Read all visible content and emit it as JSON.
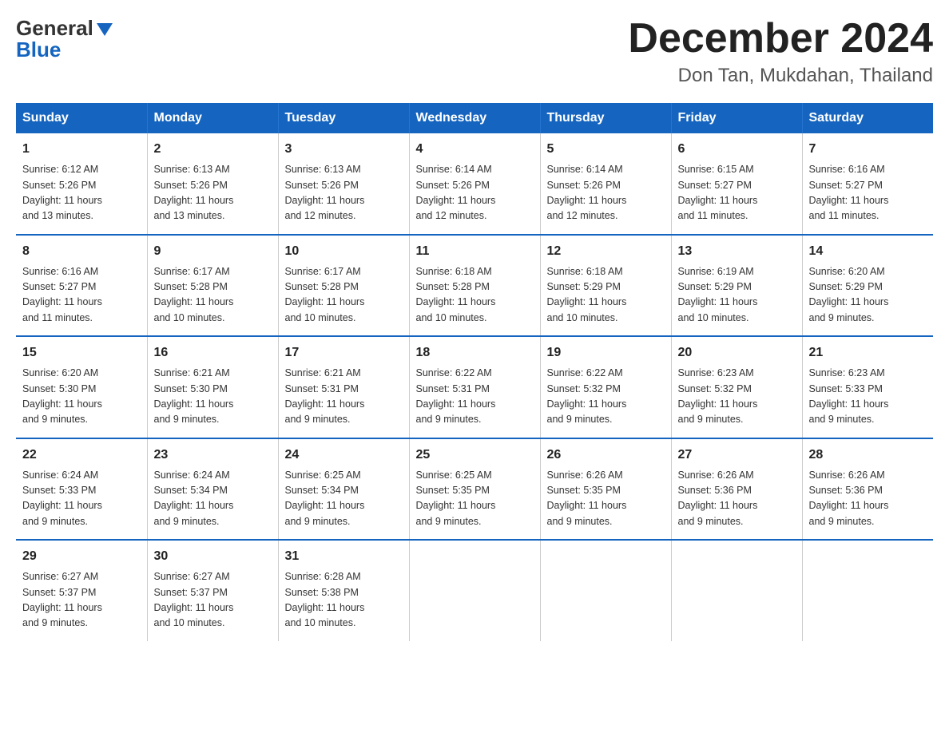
{
  "logo": {
    "general": "General",
    "blue": "Blue"
  },
  "title": "December 2024",
  "subtitle": "Don Tan, Mukdahan, Thailand",
  "days_of_week": [
    "Sunday",
    "Monday",
    "Tuesday",
    "Wednesday",
    "Thursday",
    "Friday",
    "Saturday"
  ],
  "weeks": [
    [
      {
        "day": "1",
        "info": "Sunrise: 6:12 AM\nSunset: 5:26 PM\nDaylight: 11 hours\nand 13 minutes."
      },
      {
        "day": "2",
        "info": "Sunrise: 6:13 AM\nSunset: 5:26 PM\nDaylight: 11 hours\nand 13 minutes."
      },
      {
        "day": "3",
        "info": "Sunrise: 6:13 AM\nSunset: 5:26 PM\nDaylight: 11 hours\nand 12 minutes."
      },
      {
        "day": "4",
        "info": "Sunrise: 6:14 AM\nSunset: 5:26 PM\nDaylight: 11 hours\nand 12 minutes."
      },
      {
        "day": "5",
        "info": "Sunrise: 6:14 AM\nSunset: 5:26 PM\nDaylight: 11 hours\nand 12 minutes."
      },
      {
        "day": "6",
        "info": "Sunrise: 6:15 AM\nSunset: 5:27 PM\nDaylight: 11 hours\nand 11 minutes."
      },
      {
        "day": "7",
        "info": "Sunrise: 6:16 AM\nSunset: 5:27 PM\nDaylight: 11 hours\nand 11 minutes."
      }
    ],
    [
      {
        "day": "8",
        "info": "Sunrise: 6:16 AM\nSunset: 5:27 PM\nDaylight: 11 hours\nand 11 minutes."
      },
      {
        "day": "9",
        "info": "Sunrise: 6:17 AM\nSunset: 5:28 PM\nDaylight: 11 hours\nand 10 minutes."
      },
      {
        "day": "10",
        "info": "Sunrise: 6:17 AM\nSunset: 5:28 PM\nDaylight: 11 hours\nand 10 minutes."
      },
      {
        "day": "11",
        "info": "Sunrise: 6:18 AM\nSunset: 5:28 PM\nDaylight: 11 hours\nand 10 minutes."
      },
      {
        "day": "12",
        "info": "Sunrise: 6:18 AM\nSunset: 5:29 PM\nDaylight: 11 hours\nand 10 minutes."
      },
      {
        "day": "13",
        "info": "Sunrise: 6:19 AM\nSunset: 5:29 PM\nDaylight: 11 hours\nand 10 minutes."
      },
      {
        "day": "14",
        "info": "Sunrise: 6:20 AM\nSunset: 5:29 PM\nDaylight: 11 hours\nand 9 minutes."
      }
    ],
    [
      {
        "day": "15",
        "info": "Sunrise: 6:20 AM\nSunset: 5:30 PM\nDaylight: 11 hours\nand 9 minutes."
      },
      {
        "day": "16",
        "info": "Sunrise: 6:21 AM\nSunset: 5:30 PM\nDaylight: 11 hours\nand 9 minutes."
      },
      {
        "day": "17",
        "info": "Sunrise: 6:21 AM\nSunset: 5:31 PM\nDaylight: 11 hours\nand 9 minutes."
      },
      {
        "day": "18",
        "info": "Sunrise: 6:22 AM\nSunset: 5:31 PM\nDaylight: 11 hours\nand 9 minutes."
      },
      {
        "day": "19",
        "info": "Sunrise: 6:22 AM\nSunset: 5:32 PM\nDaylight: 11 hours\nand 9 minutes."
      },
      {
        "day": "20",
        "info": "Sunrise: 6:23 AM\nSunset: 5:32 PM\nDaylight: 11 hours\nand 9 minutes."
      },
      {
        "day": "21",
        "info": "Sunrise: 6:23 AM\nSunset: 5:33 PM\nDaylight: 11 hours\nand 9 minutes."
      }
    ],
    [
      {
        "day": "22",
        "info": "Sunrise: 6:24 AM\nSunset: 5:33 PM\nDaylight: 11 hours\nand 9 minutes."
      },
      {
        "day": "23",
        "info": "Sunrise: 6:24 AM\nSunset: 5:34 PM\nDaylight: 11 hours\nand 9 minutes."
      },
      {
        "day": "24",
        "info": "Sunrise: 6:25 AM\nSunset: 5:34 PM\nDaylight: 11 hours\nand 9 minutes."
      },
      {
        "day": "25",
        "info": "Sunrise: 6:25 AM\nSunset: 5:35 PM\nDaylight: 11 hours\nand 9 minutes."
      },
      {
        "day": "26",
        "info": "Sunrise: 6:26 AM\nSunset: 5:35 PM\nDaylight: 11 hours\nand 9 minutes."
      },
      {
        "day": "27",
        "info": "Sunrise: 6:26 AM\nSunset: 5:36 PM\nDaylight: 11 hours\nand 9 minutes."
      },
      {
        "day": "28",
        "info": "Sunrise: 6:26 AM\nSunset: 5:36 PM\nDaylight: 11 hours\nand 9 minutes."
      }
    ],
    [
      {
        "day": "29",
        "info": "Sunrise: 6:27 AM\nSunset: 5:37 PM\nDaylight: 11 hours\nand 9 minutes."
      },
      {
        "day": "30",
        "info": "Sunrise: 6:27 AM\nSunset: 5:37 PM\nDaylight: 11 hours\nand 10 minutes."
      },
      {
        "day": "31",
        "info": "Sunrise: 6:28 AM\nSunset: 5:38 PM\nDaylight: 11 hours\nand 10 minutes."
      },
      {
        "day": "",
        "info": ""
      },
      {
        "day": "",
        "info": ""
      },
      {
        "day": "",
        "info": ""
      },
      {
        "day": "",
        "info": ""
      }
    ]
  ]
}
